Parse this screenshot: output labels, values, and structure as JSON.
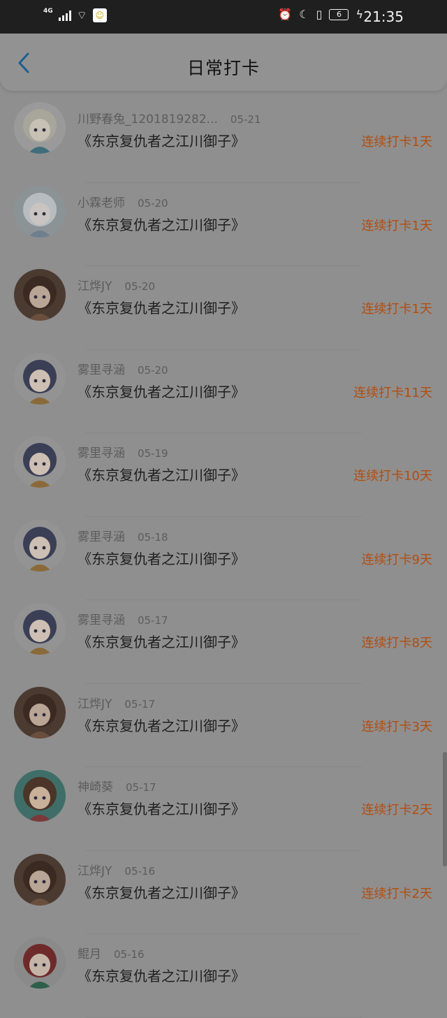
{
  "status_bar": {
    "network": "4G",
    "battery": "6",
    "time": "21:35"
  },
  "header": {
    "title": "日常打卡"
  },
  "records": [
    {
      "user": "川野春兔_1201819282...",
      "date": "05-21",
      "book": "《东京复仇者之江川御子》",
      "streak": "连续打卡1天",
      "avatar": "deer"
    },
    {
      "user": "小霖老师",
      "date": "05-20",
      "book": "《东京复仇者之江川御子》",
      "streak": "连续打卡1天",
      "avatar": "silver"
    },
    {
      "user": "江烨JY",
      "date": "05-20",
      "book": "《东京复仇者之江川御子》",
      "streak": "连续打卡1天",
      "avatar": "brown"
    },
    {
      "user": "雾里寻涵",
      "date": "05-20",
      "book": "《东京复仇者之江川御子》",
      "streak": "连续打卡11天",
      "avatar": "chibi"
    },
    {
      "user": "雾里寻涵",
      "date": "05-19",
      "book": "《东京复仇者之江川御子》",
      "streak": "连续打卡10天",
      "avatar": "chibi"
    },
    {
      "user": "雾里寻涵",
      "date": "05-18",
      "book": "《东京复仇者之江川御子》",
      "streak": "连续打卡9天",
      "avatar": "chibi"
    },
    {
      "user": "雾里寻涵",
      "date": "05-17",
      "book": "《东京复仇者之江川御子》",
      "streak": "连续打卡8天",
      "avatar": "chibi"
    },
    {
      "user": "江烨JY",
      "date": "05-17",
      "book": "《东京复仇者之江川御子》",
      "streak": "连续打卡3天",
      "avatar": "brown"
    },
    {
      "user": "神崎葵",
      "date": "05-17",
      "book": "《东京复仇者之江川御子》",
      "streak": "连续打卡2天",
      "avatar": "green"
    },
    {
      "user": "江烨JY",
      "date": "05-16",
      "book": "《东京复仇者之江川御子》",
      "streak": "连续打卡2天",
      "avatar": "brown"
    },
    {
      "user": "鲲月",
      "date": "05-16",
      "book": "《东京复仇者之江川御子》",
      "streak": "",
      "avatar": "red"
    }
  ]
}
